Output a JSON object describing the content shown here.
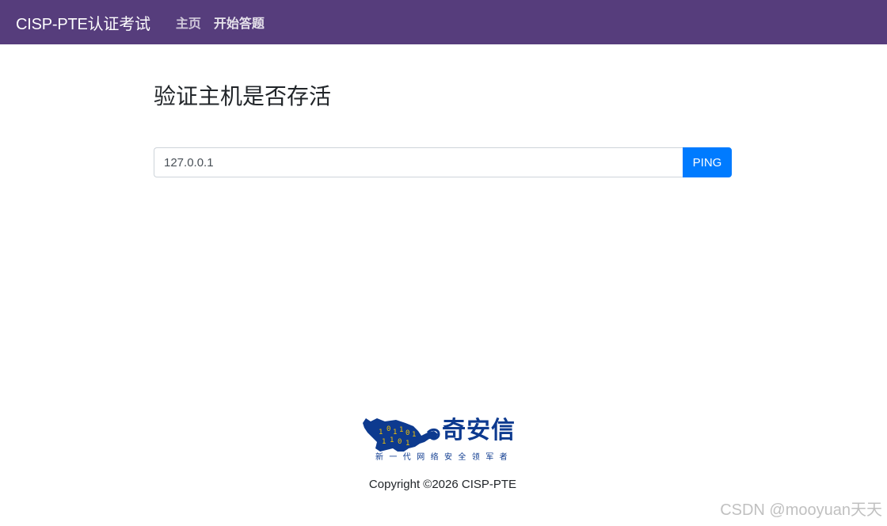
{
  "navbar": {
    "brand": "CISP-PTE认证考试",
    "links": [
      {
        "label": "主页"
      },
      {
        "label": "开始答题"
      }
    ],
    "background": "#563d7c"
  },
  "main": {
    "title": "验证主机是否存活",
    "host_input": {
      "value": "127.0.0.1",
      "placeholder": ""
    },
    "ping_button": {
      "label": "PING",
      "color": "#007bff"
    }
  },
  "footer": {
    "logo": {
      "icon": "tiger-binary-logo",
      "name": "奇安信",
      "slogan": "新一代网络安全领军者",
      "color": "#0d3a8f"
    },
    "copyright": "Copyright ©2026 CISP-PTE"
  },
  "watermark": "CSDN @mooyuan天天"
}
